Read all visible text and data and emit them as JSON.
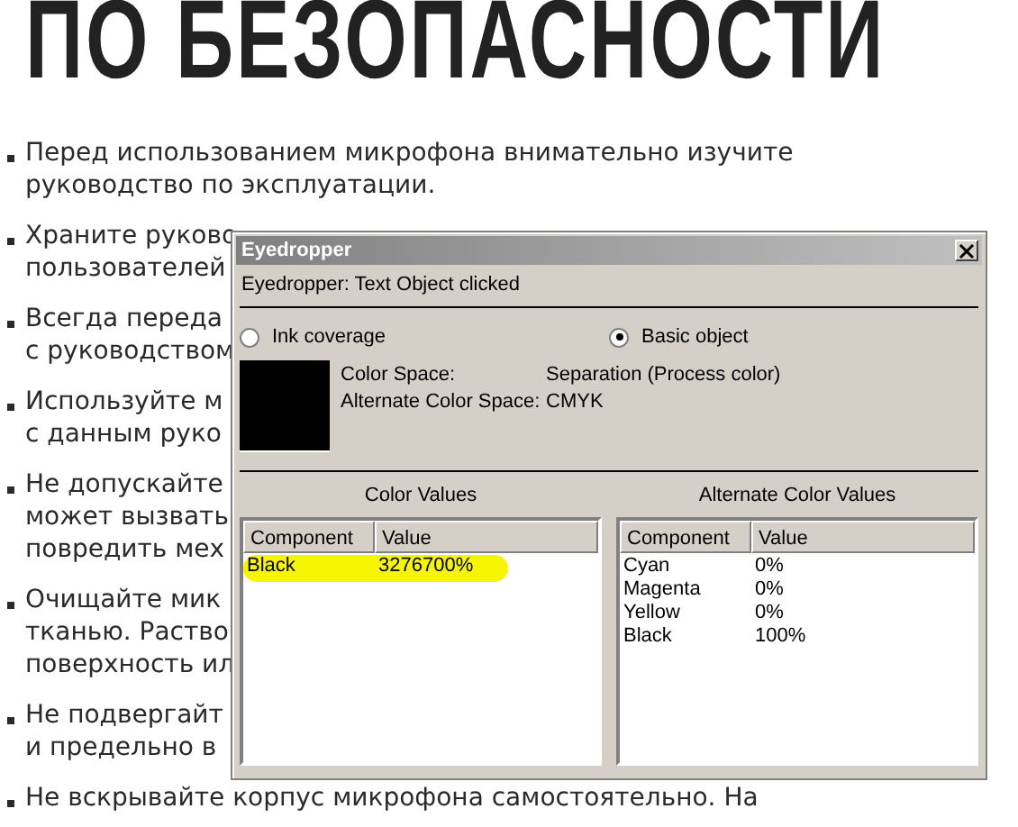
{
  "document": {
    "heading": "ПО БЕЗОПАСНОСТИ",
    "bullets": [
      {
        "lines": [
          "Перед использованием микрофона внимательно изучите",
          "руководство по эксплуатации."
        ]
      },
      {
        "lines": [
          "Храните руково",
          "пользователей"
        ]
      },
      {
        "lines": [
          "Всегда переда",
          "с руководством"
        ]
      },
      {
        "lines": [
          "Используйте м",
          "с данным руко"
        ]
      },
      {
        "lines": [
          "Не допускайте",
          "может вызвать",
          "повредить мех"
        ]
      },
      {
        "lines": [
          "Очищайте мик",
          "тканью. Раство",
          "поверхность ил"
        ]
      },
      {
        "lines": [
          "Не подвергайт",
          "и предельно в"
        ]
      },
      {
        "lines": [
          "Не вскрывайте корпус микрофона самостоятельно. На"
        ]
      }
    ]
  },
  "dialog": {
    "title": "Eyedropper",
    "status": "Eyedropper: Text Object clicked",
    "modes": [
      {
        "label": "Ink coverage",
        "selected": false
      },
      {
        "label": "Basic object",
        "selected": true
      }
    ],
    "properties": [
      {
        "label": "Color Space:",
        "value": "Separation (Process color)"
      },
      {
        "label": "Alternate Color Space:",
        "value": "CMYK"
      }
    ],
    "panels": [
      {
        "title": "Color Values",
        "columns": [
          "Component",
          "Value"
        ],
        "rows": [
          {
            "cells": [
              "Black",
              "3276700%"
            ],
            "highlighted": true
          }
        ]
      },
      {
        "title": "Alternate Color Values",
        "columns": [
          "Component",
          "Value"
        ],
        "rows": [
          {
            "cells": [
              "Cyan",
              "0%"
            ],
            "highlighted": false
          },
          {
            "cells": [
              "Magenta",
              "0%"
            ],
            "highlighted": false
          },
          {
            "cells": [
              "Yellow",
              "0%"
            ],
            "highlighted": false
          },
          {
            "cells": [
              "Black",
              "100%"
            ],
            "highlighted": false
          }
        ]
      }
    ]
  }
}
